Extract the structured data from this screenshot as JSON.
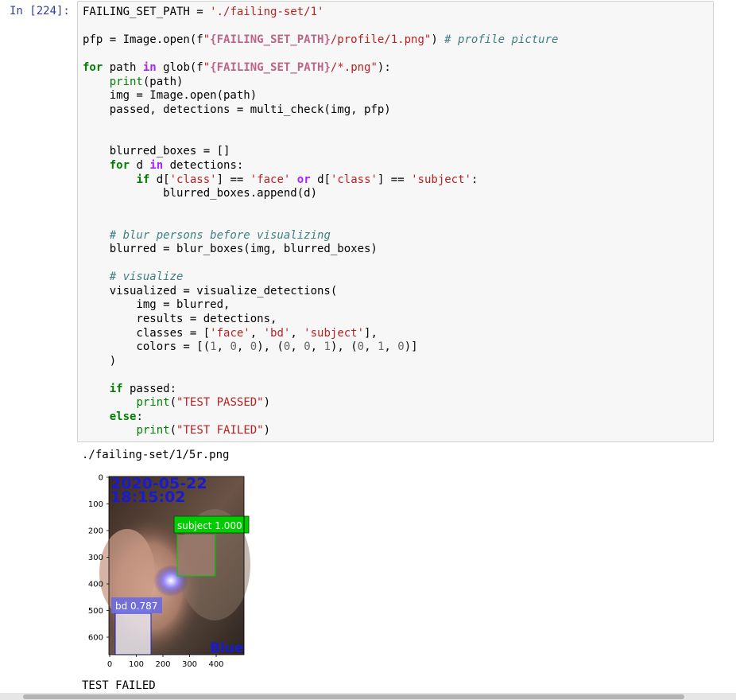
{
  "cell": {
    "prompt": "In [224]:",
    "code": {
      "l1_var": "FAILING_SET_PATH",
      "l1_op": " = ",
      "l1_str": "'./failing-set/1'",
      "l3_a": "pfp = Image.open(f",
      "l3_s1": "\"",
      "l3_si": "{FAILING_SET_PATH}",
      "l3_s2": "/profile/1.png\"",
      "l3_b": ") ",
      "l3_cm": "# profile picture",
      "l5_for": "for",
      "l5_a": " path ",
      "l5_in": "in",
      "l5_b": " glob(f",
      "l5_s1": "\"",
      "l5_si": "{FAILING_SET_PATH}",
      "l5_s2": "/*.png\"",
      "l5_c": "):",
      "l6_ind": "    ",
      "l6_print": "print",
      "l6_a": "(path)",
      "l7": "    img = Image.open(path)",
      "l8": "    passed, detections = multi_check(img, pfp)",
      "l11": "    blurred_boxes = []",
      "l12_ind": "    ",
      "l12_for": "for",
      "l12_a": " d ",
      "l12_in": "in",
      "l12_b": " detections:",
      "l13_ind": "        ",
      "l13_if": "if",
      "l13_a": " d[",
      "l13_s1": "'class'",
      "l13_b": "] == ",
      "l13_s2": "'face'",
      "l13_c": " ",
      "l13_or": "or",
      "l13_d": " d[",
      "l13_s3": "'class'",
      "l13_e": "] == ",
      "l13_s4": "'subject'",
      "l13_f": ":",
      "l14": "            blurred_boxes.append(d)",
      "l17_ind": "    ",
      "l17_cm": "# blur persons before visualizing",
      "l18": "    blurred = blur_boxes(img, blurred_boxes)",
      "l20_ind": "    ",
      "l20_cm": "# visualize",
      "l21": "    visualized = visualize_detections(",
      "l22": "        img = blurred,",
      "l23": "        results = detections,",
      "l24_a": "        classes = [",
      "l24_s1": "'face'",
      "l24_b": ", ",
      "l24_s2": "'bd'",
      "l24_c": ", ",
      "l24_s3": "'subject'",
      "l24_d": "],",
      "l25_a": "        colors = [(",
      "l25_n1": "1",
      "l25_n2": "0",
      "l25_n3": "0",
      "l25_n4": "0",
      "l25_n5": "0",
      "l25_n6": "1",
      "l25_n7": "0",
      "l25_n8": "1",
      "l25_n9": "0",
      "l25_sep": ", ",
      "l25_mid": "), (",
      "l25_end": ")]",
      "l26": "    )",
      "l28_ind": "    ",
      "l28_if": "if",
      "l28_a": " passed:",
      "l29_ind": "        ",
      "l29_print": "print",
      "l29_a": "(",
      "l29_s": "\"TEST PASSED\"",
      "l29_b": ")",
      "l30_ind": "    ",
      "l30_else": "else",
      "l30_a": ":",
      "l31_ind": "        ",
      "l31_print": "print",
      "l31_a": "(",
      "l31_s": "\"TEST FAILED\"",
      "l31_b": ")"
    }
  },
  "output": {
    "path_line": "./failing-set/1/5r.png",
    "result_line": "TEST FAILED",
    "image": {
      "timestamp_line1": "2020-05-22",
      "timestamp_line2": "18:15:02",
      "watermark": "Blue",
      "y_ticks": [
        "0",
        "100",
        "200",
        "300",
        "400",
        "500",
        "600"
      ],
      "x_ticks": [
        "0",
        "100",
        "200",
        "300",
        "400"
      ],
      "detections": [
        {
          "label": "subject 1.000",
          "color": "#00cc00"
        },
        {
          "label": "bd 0.787",
          "color": "#0000ff"
        }
      ]
    }
  }
}
